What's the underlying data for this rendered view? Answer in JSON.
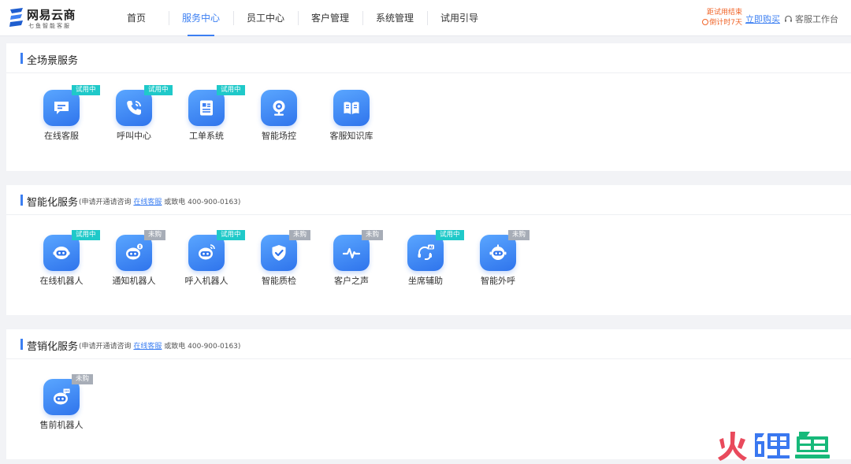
{
  "header": {
    "logo": {
      "name": "网易云商",
      "sub": "七鱼智能客服"
    },
    "nav": [
      "首页",
      "服务中心",
      "员工中心",
      "客户管理",
      "系统管理",
      "试用引导"
    ],
    "active_nav": "服务中心",
    "trial": {
      "line1": "距试用结束",
      "line2": "倒计时7天"
    },
    "buy_label": "立即购买",
    "workspace_label": "客服工作台"
  },
  "sections": [
    {
      "title": "全场景服务",
      "note": null,
      "tiles": [
        {
          "label": "在线客服",
          "badge": "试用中",
          "icon": "chat-icon"
        },
        {
          "label": "呼叫中心",
          "badge": "试用中",
          "icon": "phone-icon"
        },
        {
          "label": "工单系统",
          "badge": "试用中",
          "icon": "document-icon"
        },
        {
          "label": "智能场控",
          "badge": "",
          "icon": "webcam-icon"
        },
        {
          "label": "客服知识库",
          "badge": "",
          "icon": "book-icon"
        }
      ]
    },
    {
      "title": "智能化服务",
      "note": {
        "prefix": "(申请开通请咨询",
        "link": "在线客服",
        "suffix": "或致电 400-900-0163)"
      },
      "tiles": [
        {
          "label": "在线机器人",
          "badge": "试用中",
          "icon": "robot-icon"
        },
        {
          "label": "通知机器人",
          "badge": "未购",
          "icon": "notify-robot-icon"
        },
        {
          "label": "呼入机器人",
          "badge": "试用中",
          "icon": "inbound-robot-icon"
        },
        {
          "label": "智能质检",
          "badge": "未购",
          "icon": "shield-check-icon"
        },
        {
          "label": "客户之声",
          "badge": "未购",
          "icon": "pulse-icon"
        },
        {
          "label": "坐席辅助",
          "badge": "试用中",
          "icon": "ai-headset-icon"
        },
        {
          "label": "智能外呼",
          "badge": "未购",
          "icon": "outbound-robot-icon"
        }
      ]
    },
    {
      "title": "营销化服务",
      "note": {
        "prefix": "(申请开通请咨询",
        "link": "在线客服",
        "suffix": "或致电 400-900-0163)"
      },
      "tiles": [
        {
          "label": "售前机器人",
          "badge": "未购",
          "icon": "presale-robot-icon"
        }
      ]
    }
  ],
  "watermark": "火鲤鱼",
  "colors": {
    "accent": "#3c7ff2",
    "trial_badge": "#1fc9c9",
    "unpurchased_badge": "#a7adb7",
    "countdown": "#f06428"
  }
}
